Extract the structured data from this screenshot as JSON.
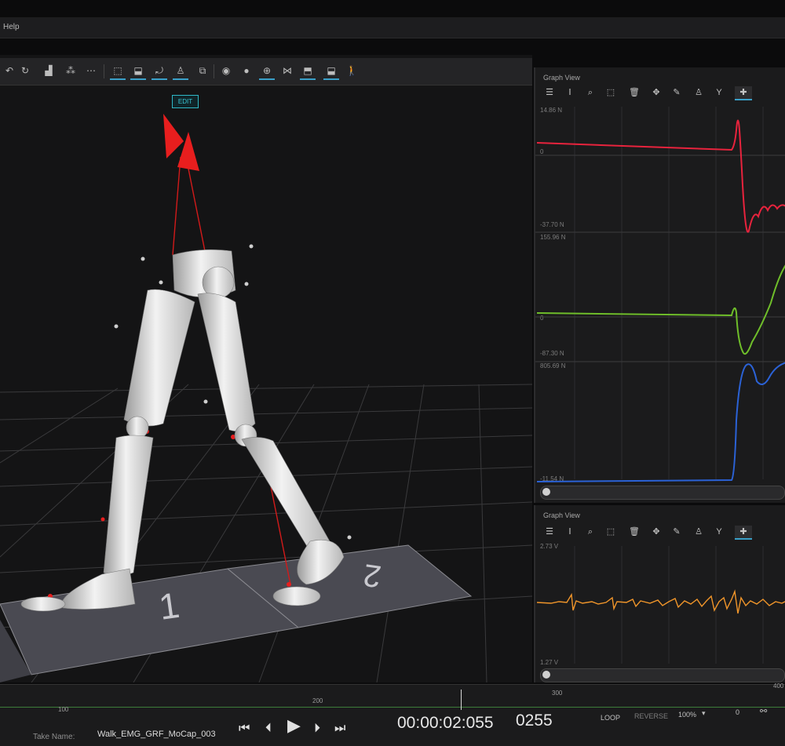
{
  "menu": {
    "help": "Help"
  },
  "viewport": {
    "edit_badge": "EDIT",
    "toolbar_icons": [
      "undo-icon",
      "redo-icon",
      "layout-icon",
      "marker-icon",
      "filter-icon",
      "select-icon",
      "translate-icon",
      "rotate-icon",
      "skeleton-icon",
      "bone-icon",
      "eye-icon",
      "marker-set-icon",
      "rigid-body-icon",
      "segment-icon",
      "force-plate-icon",
      "device-icon",
      "walk-icon"
    ],
    "plate_numbers": [
      "1",
      "2"
    ]
  },
  "graph_top": {
    "title": "Graph View",
    "tools": [
      "settings-icon",
      "text-cursor-icon",
      "zoom-icon",
      "select-range-icon",
      "trash-icon",
      "move-icon",
      "pen-icon",
      "person-icon",
      "fork-icon",
      "add-icon"
    ],
    "series": [
      {
        "color": "#e8233d",
        "max": "14.86 N",
        "zero": "0",
        "min": "-37.70 N"
      },
      {
        "color": "#6fbe2a",
        "max": "155.96 N",
        "zero": "0",
        "min": "-87.30 N"
      },
      {
        "color": "#2b62d6",
        "max": "805.69 N",
        "zero": "",
        "min": "-11.54 N"
      }
    ]
  },
  "graph_bottom": {
    "title": "Graph View",
    "tools": [
      "settings-icon",
      "text-cursor-icon",
      "zoom-icon",
      "select-range-icon",
      "trash-icon",
      "move-icon",
      "pen-icon",
      "person-icon",
      "fork-icon",
      "add-icon"
    ],
    "series": [
      {
        "color": "#f0952a",
        "max": "2.73 V",
        "min": "1.27 V"
      }
    ]
  },
  "timeline": {
    "ticks": [
      "100",
      "200",
      "300",
      "400"
    ],
    "take_label": "Take Name:",
    "take_name": "Walk_EMG_GRF_MoCap_003",
    "timecode": "00:00:02:055",
    "frame": "0255",
    "loop": "LOOP",
    "reverse": "REVERSE",
    "speed": "100%",
    "offset": "0"
  }
}
